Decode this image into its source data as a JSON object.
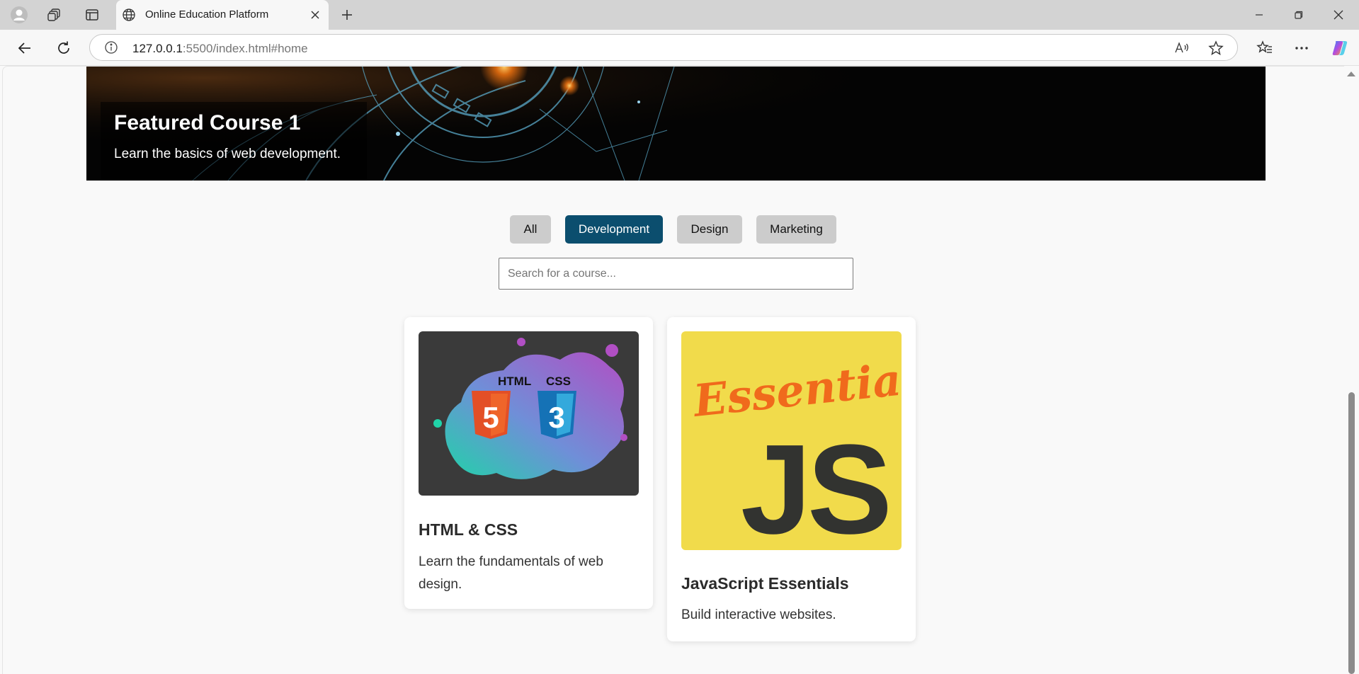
{
  "browser": {
    "tab_title": "Online Education Platform",
    "url_host": "127.0.0.1",
    "url_rest": ":5500/index.html#home",
    "icons": [
      "profile-icon",
      "workspaces-icon",
      "tab-actions-icon",
      "globe-icon",
      "close-icon",
      "new-tab-icon",
      "minimize-icon",
      "restore-icon",
      "close-window-icon",
      "back-icon",
      "refresh-icon",
      "info-icon",
      "read-aloud-icon",
      "favorite-star-icon",
      "favorites-icon",
      "more-icon",
      "copilot-icon"
    ]
  },
  "hero": {
    "title": "Featured Course 1",
    "subtitle": "Learn the basics of web development."
  },
  "filters": {
    "items": [
      {
        "label": "All",
        "active": false
      },
      {
        "label": "Development",
        "active": true
      },
      {
        "label": "Design",
        "active": false
      },
      {
        "label": "Marketing",
        "active": false
      }
    ],
    "active_color": "#0b4e6e",
    "inactive_color": "#cccccc"
  },
  "search": {
    "placeholder": "Search for a course...",
    "value": ""
  },
  "courses": [
    {
      "title": "HTML & CSS",
      "description": "Learn the fundamentals of web design.",
      "image_labels": [
        "HTML",
        "CSS",
        "5",
        "3"
      ]
    },
    {
      "title": "JavaScript Essentials",
      "description": "Build interactive websites.",
      "image_labels": [
        "Essentials",
        "JS"
      ]
    }
  ]
}
